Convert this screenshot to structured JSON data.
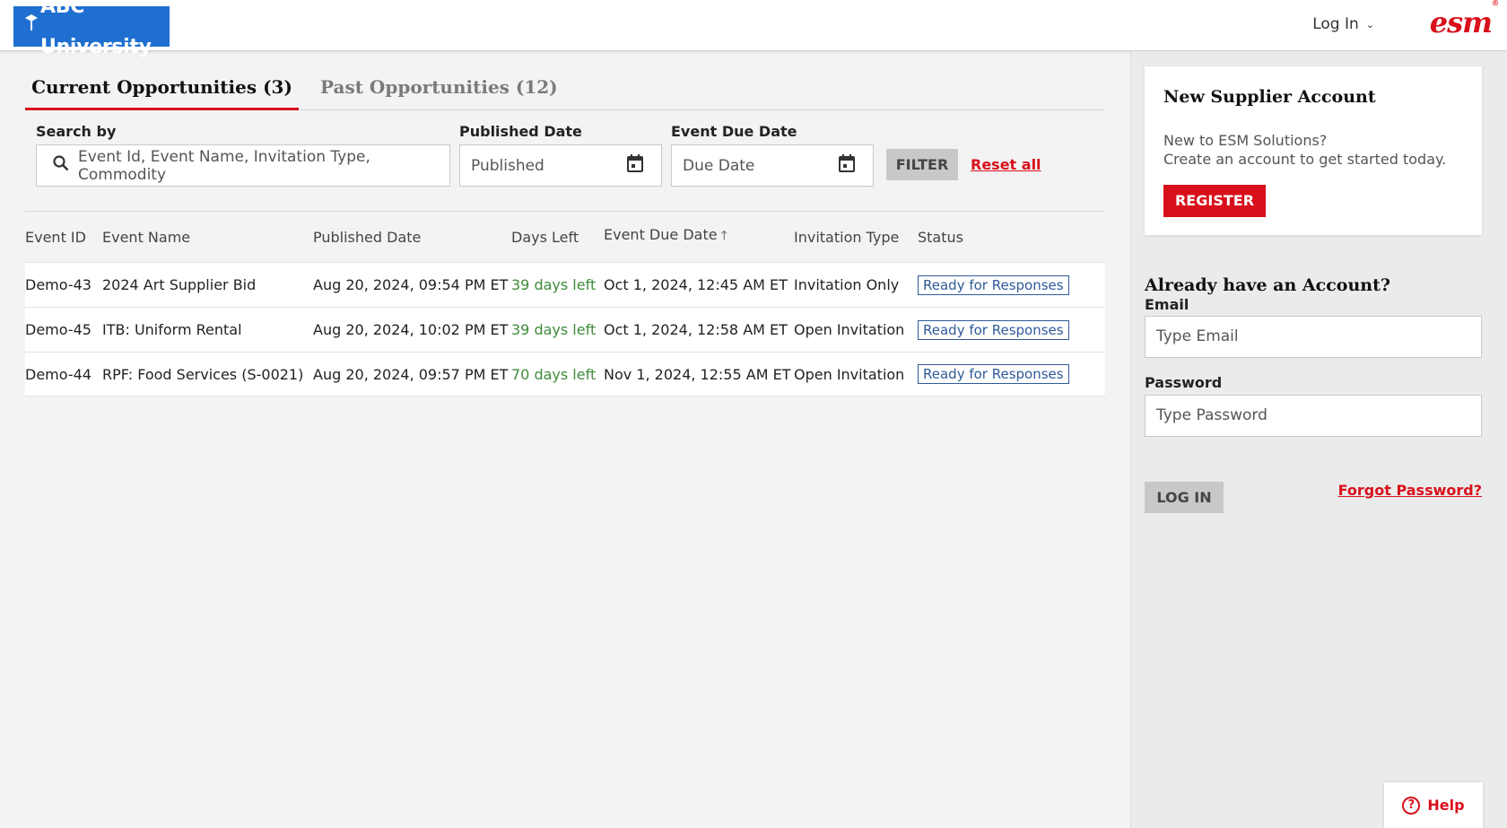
{
  "header": {
    "logo_text": "ABC University",
    "login_label": "Log In",
    "brand": "esm"
  },
  "tabs": [
    {
      "label": "Current Opportunities (3)",
      "active": true
    },
    {
      "label": "Past Opportunities (12)",
      "active": false
    }
  ],
  "filters": {
    "search_label": "Search by",
    "search_placeholder": "Event Id, Event Name, Invitation Type, Commodity",
    "published_label": "Published Date",
    "published_placeholder": "Published",
    "due_label": "Event Due Date",
    "due_placeholder": "Due Date",
    "filter_button": "FILTER",
    "reset_link": "Reset all"
  },
  "table": {
    "headers": [
      "Event ID",
      "Event Name",
      "Published Date",
      "Days Left",
      "Event Due Date",
      "Invitation Type",
      "Status"
    ],
    "rows": [
      {
        "id": "Demo-43",
        "name": "2024 Art Supplier Bid",
        "published": "Aug 20, 2024, 09:54 PM ET",
        "days_left": "39 days left",
        "due": "Oct 1, 2024, 12:45 AM ET",
        "invitation": "Invitation Only",
        "status": "Ready for Responses"
      },
      {
        "id": "Demo-45",
        "name": "ITB: Uniform Rental",
        "published": "Aug 20, 2024, 10:02 PM ET",
        "days_left": "39 days left",
        "due": "Oct 1, 2024, 12:58 AM ET",
        "invitation": "Open Invitation",
        "status": "Ready for Responses"
      },
      {
        "id": "Demo-44",
        "name": "RPF: Food Services (S-0021)",
        "published": "Aug 20, 2024, 09:57 PM ET",
        "days_left": "70 days left",
        "due": "Nov 1, 2024, 12:55 AM ET",
        "invitation": "Open Invitation",
        "status": "Ready for Responses"
      }
    ]
  },
  "sidebar": {
    "new_account_title": "New Supplier Account",
    "new_account_line1": "New to ESM Solutions?",
    "new_account_line2": "Create an account to get started today.",
    "register_button": "REGISTER",
    "already_title": "Already have an Account?",
    "email_label": "Email",
    "email_placeholder": "Type Email",
    "password_label": "Password",
    "password_placeholder": "Type Password",
    "login_button": "LOG IN",
    "forgot_link": "Forgot Password?"
  },
  "help": {
    "label": "Help"
  },
  "colors": {
    "accent_red": "#d8101b",
    "logo_blue": "#1f6fd1",
    "days_green": "#3e8b3a",
    "status_blue": "#2f5a9a"
  },
  "icons": [
    "university-cap-icon",
    "chevron-down-icon",
    "search-icon",
    "calendar-icon",
    "sort-up-icon",
    "help-icon"
  ]
}
